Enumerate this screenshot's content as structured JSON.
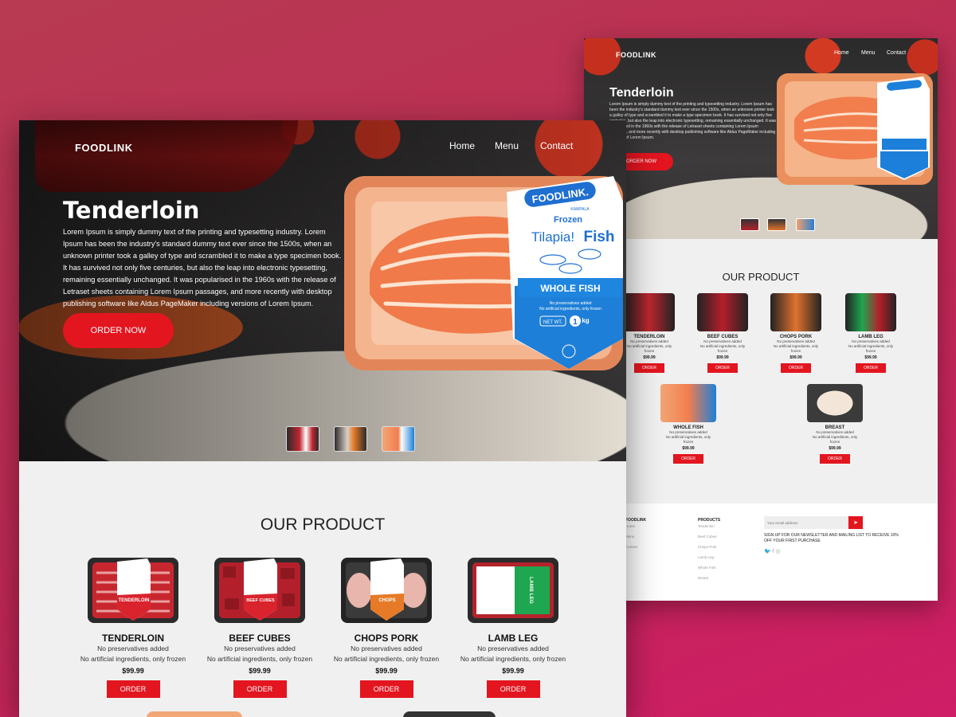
{
  "brand": "FOODLINK",
  "nav": [
    "Home",
    "Menu",
    "Contact"
  ],
  "hero": {
    "title": "Tenderloin",
    "description": "Lorem Ipsum is simply dummy text of the printing and typesetting industry. Lorem Ipsum has been the industry's standard dummy text ever since the 1500s, when an unknown printer took a galley of type and scrambled it to make a type specimen book. It has survived not only five centuries, but also the leap into electronic typesetting, remaining essentially unchanged. It was popularised in the 1960s with the release of Letraset sheets containing Lorem Ipsum passages, and more recently with desktop publishing software like Aldus PageMaker including versions of Lorem Ipsum.",
    "button": "ORDER NOW"
  },
  "package": {
    "brand": "FOODLINK.",
    "sub": "KAMPALA",
    "frozen": "Frozen",
    "name1": "Tilapia!",
    "name2": "Fish",
    "banner": "WHOLE FISH",
    "note1": "No preservatives added",
    "note2": "No artificial ingredients, only frozen",
    "netwt": "NET WT.",
    "weight": "1",
    "unit": "kg"
  },
  "section_title": "OUR PRODUCT",
  "products": [
    {
      "name": "TENDERLOIN",
      "line1": "No preservatives added",
      "line2": "No artificial ingredients, only frozen",
      "price": "$99.99",
      "button": "ORDER",
      "label": "TENDERLOIN",
      "accent": "#d9232d"
    },
    {
      "name": "BEEF CUBES",
      "line1": "No preservatives added",
      "line2": "No artificial ingredients, only frozen",
      "price": "$99.99",
      "button": "ORDER",
      "label": "BEEF CUBES",
      "accent": "#d9232d"
    },
    {
      "name": "CHOPS PORK",
      "line1": "No preservatives added",
      "line2": "No artificial ingredients, only frozen",
      "price": "$99.99",
      "button": "ORDER",
      "label": "CHOPS",
      "accent": "#e67a27"
    },
    {
      "name": "LAMB LEG",
      "line1": "No preservatives added",
      "line2": "No artificial ingredients, only frozen",
      "price": "$99.99",
      "button": "ORDER",
      "label": "LAMB LEG",
      "accent": "#1ea650"
    },
    {
      "name": "WHOLE FISH",
      "line1": "No preservatives added",
      "line2": "No artificial ingredients, only frozen",
      "price": "$99.99",
      "button": "ORDER",
      "label": "",
      "accent": "#1e7fd8"
    },
    {
      "name": "BREAST",
      "line1": "No preservatives added",
      "line2": "No artificial ingredients, only frozen",
      "price": "$99.99",
      "button": "ORDER",
      "label": "",
      "accent": "#e9d9c7"
    }
  ],
  "footer": {
    "col1_title": "FOODLINK",
    "col1_links": [
      "Home",
      "Menu",
      "Contact"
    ],
    "col2_title": "PRODUCTS",
    "col2_links": [
      "Tenderloin",
      "Beef Cubes",
      "Chops Pork",
      "Lamb Leg",
      "Whole Fish",
      "Breast"
    ],
    "email_placeholder": "Your email address",
    "signup_text": "SIGN UP FOR OUR NEWSLETTER AND MAILING LIST TO RECEIVE 10% OFF YOUR FIRST PURCHASE",
    "social_icons": [
      "twitter-icon",
      "facebook-icon",
      "instagram-icon"
    ]
  },
  "colors": {
    "accent": "#e3151f",
    "background": "#c02855"
  }
}
